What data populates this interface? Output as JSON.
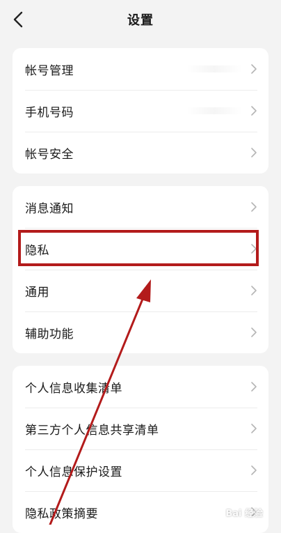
{
  "header": {
    "title": "设置",
    "back_icon": "chevron-left-icon"
  },
  "groups": [
    {
      "items": [
        {
          "label": "帐号管理"
        },
        {
          "label": "手机号码"
        },
        {
          "label": "帐号安全"
        }
      ]
    },
    {
      "items": [
        {
          "label": "消息通知"
        },
        {
          "label": "隐私"
        },
        {
          "label": "通用"
        },
        {
          "label": "辅助功能"
        }
      ]
    },
    {
      "items": [
        {
          "label": "个人信息收集清单"
        },
        {
          "label": "第三方个人信息共享清单"
        },
        {
          "label": "个人信息保护设置"
        },
        {
          "label": "隐私政策摘要"
        }
      ]
    }
  ],
  "annotation": {
    "highlight_color": "#b31b1b",
    "arrow_color": "#b31b1b"
  },
  "watermark": {
    "text": "Bai  经验"
  }
}
